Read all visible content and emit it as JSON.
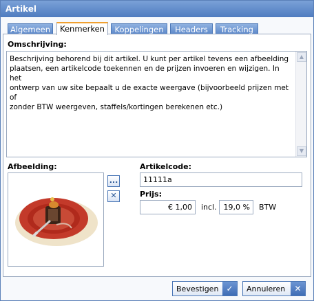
{
  "window": {
    "title": "Artikel"
  },
  "tabs": [
    {
      "label": "Algemeen"
    },
    {
      "label": "Kenmerken"
    },
    {
      "label": "Koppelingen"
    },
    {
      "label": "Headers"
    },
    {
      "label": "Tracking"
    }
  ],
  "description": {
    "label": "Omschrijving:",
    "lines": [
      "Beschrijving behorend bij dit artikel. U kunt per artikel tevens een afbeelding",
      "plaatsen, een artikelcode toekennen en de prijzen invoeren en wijzigen. In het",
      "ontwerp van uw site bepaalt u de exacte weergave (bijvoorbeeld prijzen met of",
      "zonder BTW weergeven, staffels/kortingen berekenen etc.)"
    ]
  },
  "image": {
    "label": "Afbeelding:",
    "browse_label": "...",
    "remove_icon": "close-icon"
  },
  "article_code": {
    "label": "Artikelcode:",
    "value": "11111a"
  },
  "price": {
    "label": "Prijs:",
    "value": "€ 1,00",
    "incl_label": "incl.",
    "vat_value": "19,0 %",
    "vat_label": "BTW"
  },
  "buttons": {
    "confirm": "Bevestigen",
    "cancel": "Annuleren"
  },
  "colors": {
    "titlebar": "#5f8ccb",
    "tab_active_top": "#f0a030",
    "button_icon": "#3f6db5"
  }
}
